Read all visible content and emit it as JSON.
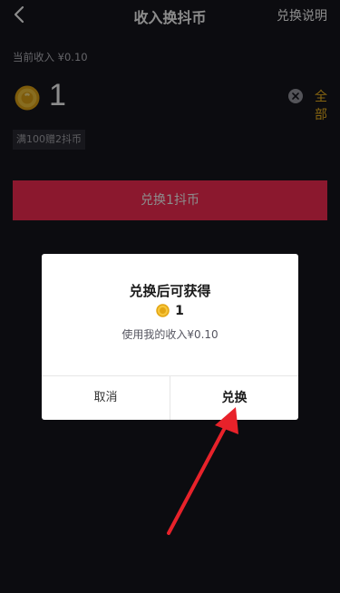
{
  "header": {
    "title": "收入换抖币",
    "help_label": "兑换说明",
    "back_icon": "chevron-left-icon"
  },
  "balance": {
    "income_line": "当前收入 ¥0.10",
    "coin_amount": "1",
    "all_label": "全部",
    "promo": "满100赠2抖币",
    "exchange_button": "兑换1抖币"
  },
  "dialog": {
    "title": "兑换后可获得",
    "coin_amount": "1",
    "description": "使用我的收入¥0.10",
    "cancel_label": "取消",
    "confirm_label": "兑换"
  },
  "colors": {
    "background": "#16161e",
    "accent": "#fe2c55",
    "coin_gold": "#f5b820",
    "annotation_arrow": "#e8222a"
  }
}
